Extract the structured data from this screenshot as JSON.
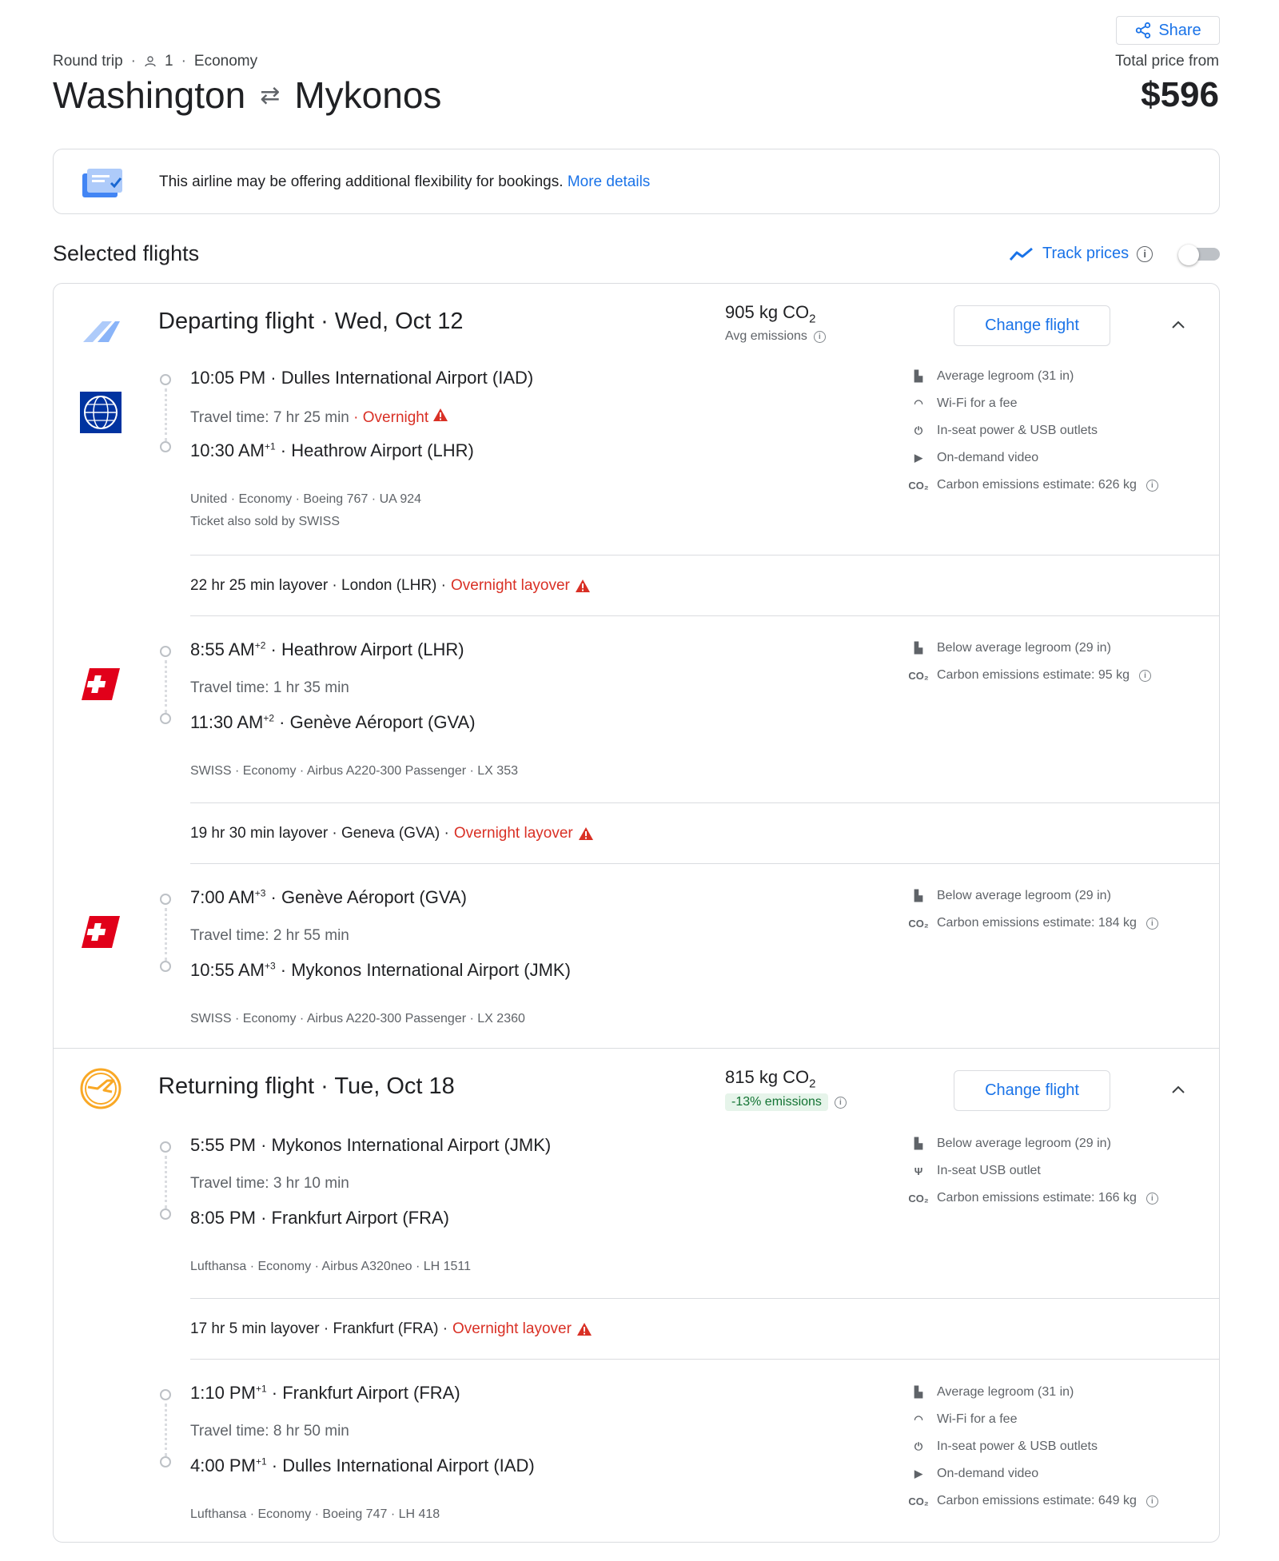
{
  "header": {
    "share_label": "Share",
    "trip_type": "Round trip",
    "passengers": "1",
    "cabin": "Economy",
    "origin": "Washington",
    "destination": "Mykonos",
    "price_label": "Total price from",
    "price": "$596"
  },
  "banner": {
    "text": "This airline may be offering additional flexibility for bookings.",
    "link": "More details"
  },
  "selected": {
    "title": "Selected flights",
    "track_label": "Track prices",
    "track_enabled": false
  },
  "departing": {
    "title": "Departing flight",
    "date": "Wed, Oct 12",
    "co2_value": "905 kg CO",
    "co2_sub": "2",
    "co2_label": "Avg emissions",
    "change_label": "Change flight",
    "segments": [
      {
        "airline_logo": "united-globe",
        "dep_time": "10:05 PM",
        "dep_sup": "",
        "dep_airport": "Dulles International Airport (IAD)",
        "travel_time": "Travel time: 7 hr 25 min",
        "travel_flag": "Overnight",
        "arr_time": "10:30 AM",
        "arr_sup": "+1",
        "arr_airport": "Heathrow Airport (LHR)",
        "details": "United · Economy · Boeing 767 · UA 924",
        "details2": "Ticket also sold by SWISS",
        "amenities": [
          {
            "icon": "legroom-icon",
            "text": "Average legroom (31 in)"
          },
          {
            "icon": "wifi-icon",
            "text": "Wi-Fi for a fee"
          },
          {
            "icon": "power-icon",
            "text": "In-seat power & USB outlets"
          },
          {
            "icon": "video-icon",
            "text": "On-demand video"
          },
          {
            "icon": "co2-icon",
            "text": "Carbon emissions estimate: 626 kg"
          }
        ]
      },
      {
        "airline_logo": "swiss-flag",
        "dep_time": "8:55 AM",
        "dep_sup": "+2",
        "dep_airport": "Heathrow Airport (LHR)",
        "travel_time": "Travel time: 1 hr 35 min",
        "travel_flag": "",
        "arr_time": "11:30 AM",
        "arr_sup": "+2",
        "arr_airport": "Genève Aéroport (GVA)",
        "details": "SWISS · Economy · Airbus A220-300 Passenger · LX 353",
        "details2": "",
        "amenities": [
          {
            "icon": "legroom-icon",
            "text": "Below average legroom (29 in)"
          },
          {
            "icon": "co2-icon",
            "text": "Carbon emissions estimate: 95 kg"
          }
        ]
      },
      {
        "airline_logo": "swiss-flag",
        "dep_time": "7:00 AM",
        "dep_sup": "+3",
        "dep_airport": "Genève Aéroport (GVA)",
        "travel_time": "Travel time: 2 hr 55 min",
        "travel_flag": "",
        "arr_time": "10:55 AM",
        "arr_sup": "+3",
        "arr_airport": "Mykonos International Airport (JMK)",
        "details": "SWISS · Economy · Airbus A220-300 Passenger · LX 2360",
        "details2": "",
        "amenities": [
          {
            "icon": "legroom-icon",
            "text": "Below average legroom (29 in)"
          },
          {
            "icon": "co2-icon",
            "text": "Carbon emissions estimate: 184 kg"
          }
        ]
      }
    ],
    "layovers": [
      {
        "text": "22 hr 25 min layover · London (LHR) · ",
        "flag": "Overnight layover"
      },
      {
        "text": "19 hr 30 min layover · Geneva (GVA) · ",
        "flag": "Overnight layover"
      }
    ]
  },
  "returning": {
    "title": "Returning flight",
    "date": "Tue, Oct 18",
    "co2_value": "815 kg CO",
    "co2_sub": "2",
    "co2_badge": "-13% emissions",
    "change_label": "Change flight",
    "segments": [
      {
        "airline_logo": "lufthansa-crane",
        "dep_time": "5:55 PM",
        "dep_sup": "",
        "dep_airport": "Mykonos International Airport (JMK)",
        "travel_time": "Travel time: 3 hr 10 min",
        "travel_flag": "",
        "arr_time": "8:05 PM",
        "arr_sup": "",
        "arr_airport": "Frankfurt Airport (FRA)",
        "details": "Lufthansa · Economy · Airbus A320neo · LH 1511",
        "details2": "",
        "amenities": [
          {
            "icon": "legroom-icon",
            "text": "Below average legroom (29 in)"
          },
          {
            "icon": "usb-icon",
            "text": "In-seat USB outlet"
          },
          {
            "icon": "co2-icon",
            "text": "Carbon emissions estimate: 166 kg"
          }
        ]
      },
      {
        "airline_logo": "lufthansa-crane",
        "dep_time": "1:10 PM",
        "dep_sup": "+1",
        "dep_airport": "Frankfurt Airport (FRA)",
        "travel_time": "Travel time: 8 hr 50 min",
        "travel_flag": "",
        "arr_time": "4:00 PM",
        "arr_sup": "+1",
        "arr_airport": "Dulles International Airport (IAD)",
        "details": "Lufthansa · Economy · Boeing 747 · LH 418",
        "details2": "",
        "amenities": [
          {
            "icon": "legroom-icon",
            "text": "Average legroom (31 in)"
          },
          {
            "icon": "wifi-icon",
            "text": "Wi-Fi for a fee"
          },
          {
            "icon": "power-icon",
            "text": "In-seat power & USB outlets"
          },
          {
            "icon": "video-icon",
            "text": "On-demand video"
          },
          {
            "icon": "co2-icon",
            "text": "Carbon emissions estimate: 649 kg"
          }
        ]
      }
    ],
    "layovers": [
      {
        "text": "17 hr 5 min layover · Frankfurt (FRA) · ",
        "flag": "Overnight layover"
      }
    ]
  },
  "colors": {
    "accent": "#1a73e8",
    "warning": "#d93025",
    "eco_green": "#137333",
    "border": "#dadce0"
  }
}
